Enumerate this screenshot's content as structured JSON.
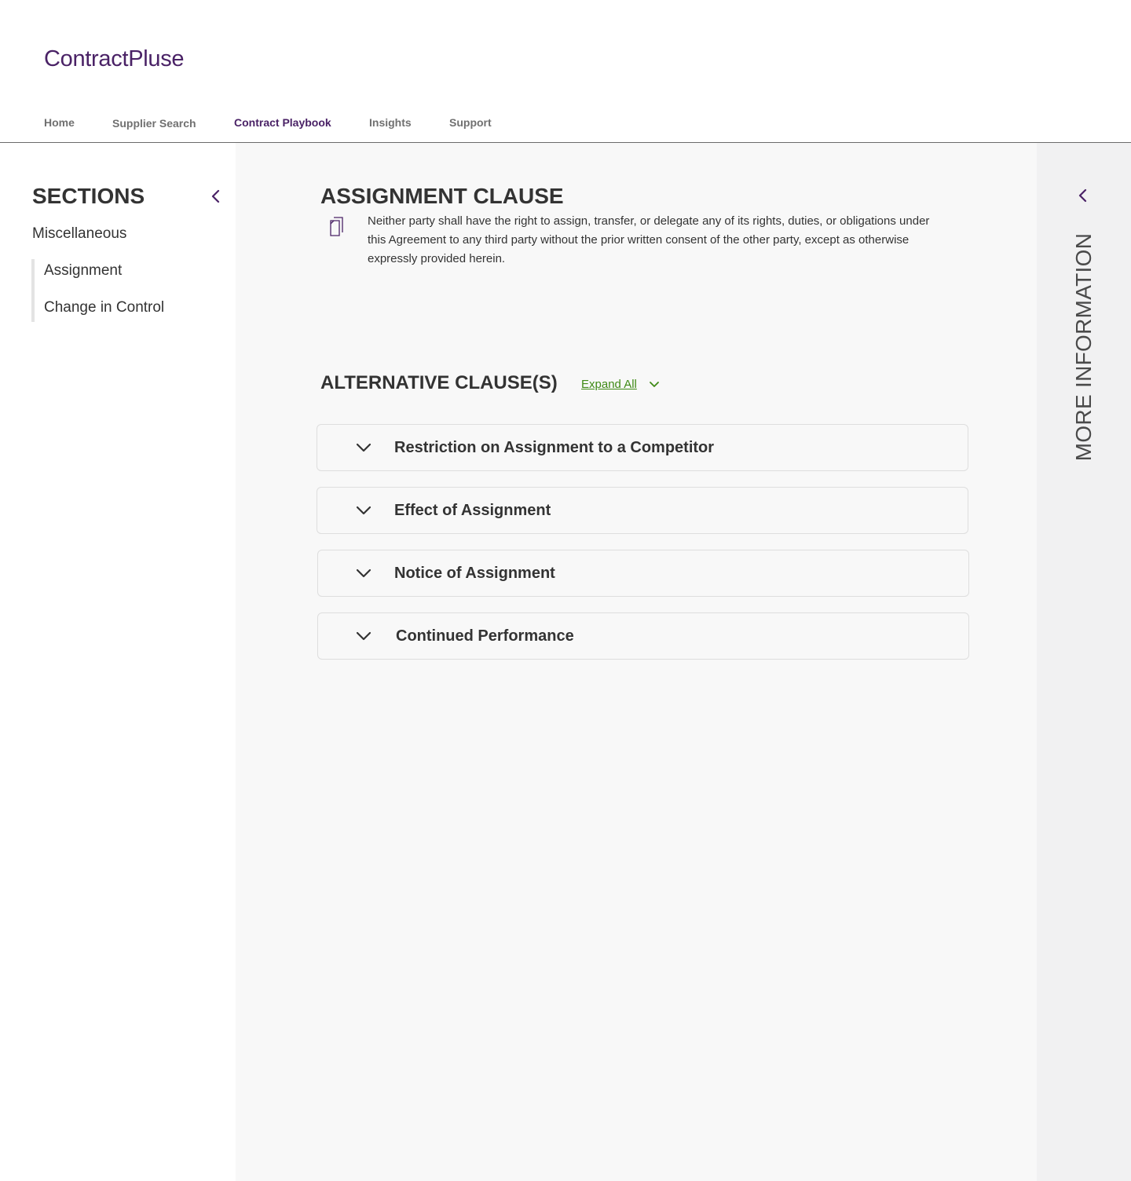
{
  "app": {
    "logo": "ContractPluse"
  },
  "nav": {
    "items": [
      {
        "label": "Home"
      },
      {
        "label": "Supplier Search"
      },
      {
        "label": "Contract Playbook"
      },
      {
        "label": "Insights"
      },
      {
        "label": "Support"
      }
    ],
    "active": "Contract Playbook"
  },
  "sidebar": {
    "title": "SECTIONS",
    "collapse_icon": "chevron-left-icon",
    "group": "Miscellaneous",
    "items": [
      {
        "label": "Assignment"
      },
      {
        "label": "Change in Control"
      }
    ]
  },
  "main": {
    "clause_title": "ASSIGNMENT CLAUSE",
    "copy_icon": "copy-icon",
    "clause_text": "Neither party shall have the right to assign, transfer, or delegate any of its rights, duties, or obligations under this Agreement to any third party without the prior written consent of the other party, except as otherwise expressly provided herein.",
    "alternatives_title": "ALTERNATIVE CLAUSE(S)",
    "expand_all": "Expand All",
    "alternatives": [
      {
        "label": "Restriction on Assignment to a Competitor"
      },
      {
        "label": "Effect of Assignment"
      },
      {
        "label": "Notice of Assignment"
      },
      {
        "label": "Continued Performance"
      }
    ]
  },
  "right_panel": {
    "title": "MORE INFORMATION",
    "collapse_icon": "chevron-left-icon"
  },
  "colors": {
    "brand": "#4a2266",
    "link": "#3f8a16",
    "text": "#333333",
    "main_bg": "#f8f8f8",
    "panel_bg": "#f1f1f2"
  }
}
